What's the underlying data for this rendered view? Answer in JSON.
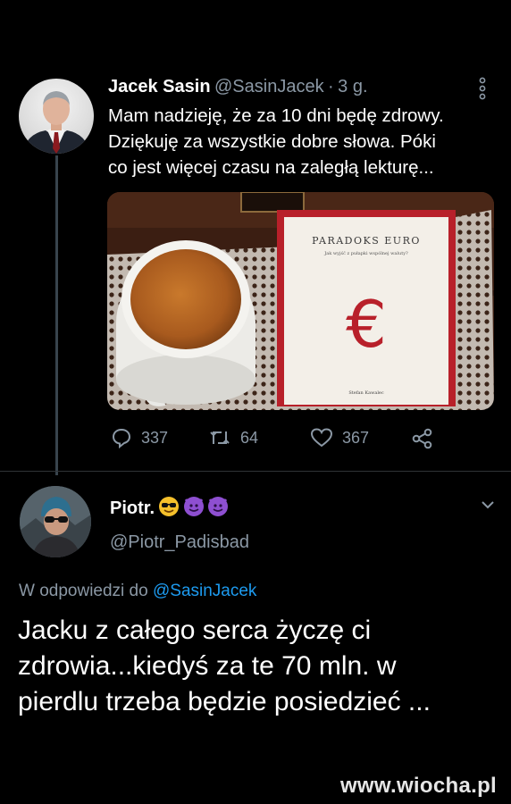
{
  "tweet": {
    "author_name": "Jacek Sasin",
    "author_handle": "@SasinJacek",
    "separator": "·",
    "time": "3 g.",
    "text_lines": [
      "Mam nadzieję, że za 10 dni będę zdrowy.",
      "Dziękuję za wszystkie dobre słowa. Póki",
      "co jest więcej czasu na zaległą lekturę..."
    ],
    "media": {
      "book_title": "PARADOKS EURO",
      "book_subtitle": "Jak wyjść z pułapki wspólnej waluty?",
      "book_author": "Stefan Kawalec",
      "book_symbol": "€"
    },
    "stats": {
      "replies": "337",
      "retweets": "64",
      "likes": "367"
    }
  },
  "reply": {
    "author_name": "Piotr.",
    "author_handle": "@Piotr_Padisbad",
    "replying_prefix": "W odpowiedzi do",
    "replying_to": "@SasinJacek",
    "text_lines": [
      "Jacku z całego serca życzę ci",
      "zdrowia...kiedyś za te 70 mln. w",
      "pierdlu trzeba będzie posiedzieć ..."
    ]
  },
  "watermark": "www.wiocha.pl",
  "colors": {
    "background": "#000000",
    "secondary_text": "#8b98a5",
    "link": "#1d9bf0",
    "thread_line": "#38444d"
  }
}
